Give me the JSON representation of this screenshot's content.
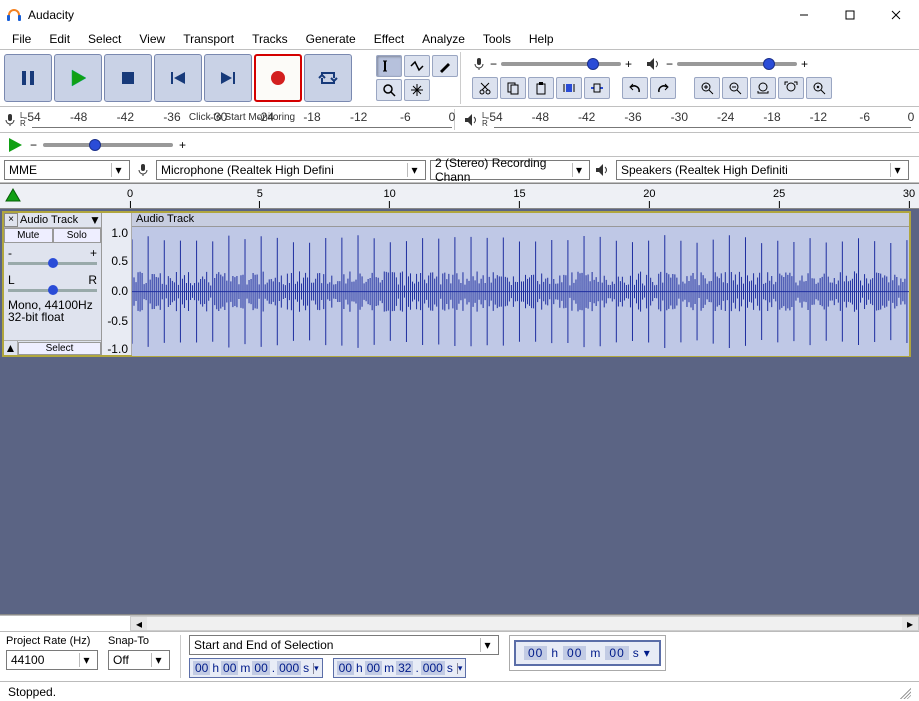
{
  "app": {
    "title": "Audacity"
  },
  "menu": [
    "File",
    "Edit",
    "Select",
    "View",
    "Transport",
    "Tracks",
    "Generate",
    "Effect",
    "Analyze",
    "Tools",
    "Help"
  ],
  "meter": {
    "rec_ticks": [
      "-54",
      "-48",
      "-42",
      "-36",
      "-30",
      "-24",
      "-18",
      "-12",
      "-6",
      "0"
    ],
    "rec_click_label": "Click to Start Monitoring",
    "play_ticks": [
      "-54",
      "-48",
      "-42",
      "-36",
      "-30",
      "-24",
      "-18",
      "-12",
      "-6",
      "0"
    ]
  },
  "devices": {
    "host": "MME",
    "input": "Microphone (Realtek High Defini",
    "channels": "2 (Stereo) Recording Chann",
    "output": "Speakers (Realtek High Definiti"
  },
  "timeline": {
    "labels": [
      "0",
      "5",
      "10",
      "15",
      "20",
      "25",
      "30"
    ]
  },
  "track": {
    "panel_name": "Audio Track",
    "mute": "Mute",
    "solo": "Solo",
    "gain_minus": "-",
    "gain_plus": "+",
    "pan_l": "L",
    "pan_r": "R",
    "info1": "Mono, 44100Hz",
    "info2": "32-bit float",
    "select": "Select",
    "clip_title": "Audio Track",
    "scale": [
      "1.0",
      "0.5",
      "0.0",
      "-0.5",
      "-1.0"
    ]
  },
  "bottom": {
    "project_rate_label": "Project Rate (Hz)",
    "project_rate": "44100",
    "snap_label": "Snap-To",
    "snap": "Off",
    "selection_mode": "Start and End of Selection",
    "sel_start": {
      "h": "00",
      "m": "00",
      "s": "00",
      "ms": "000"
    },
    "sel_end": {
      "h": "00",
      "m": "00",
      "s": "32",
      "ms": "000"
    },
    "big_time": {
      "h": "00",
      "m": "00",
      "s": "00"
    }
  },
  "status": {
    "text": "Stopped."
  }
}
